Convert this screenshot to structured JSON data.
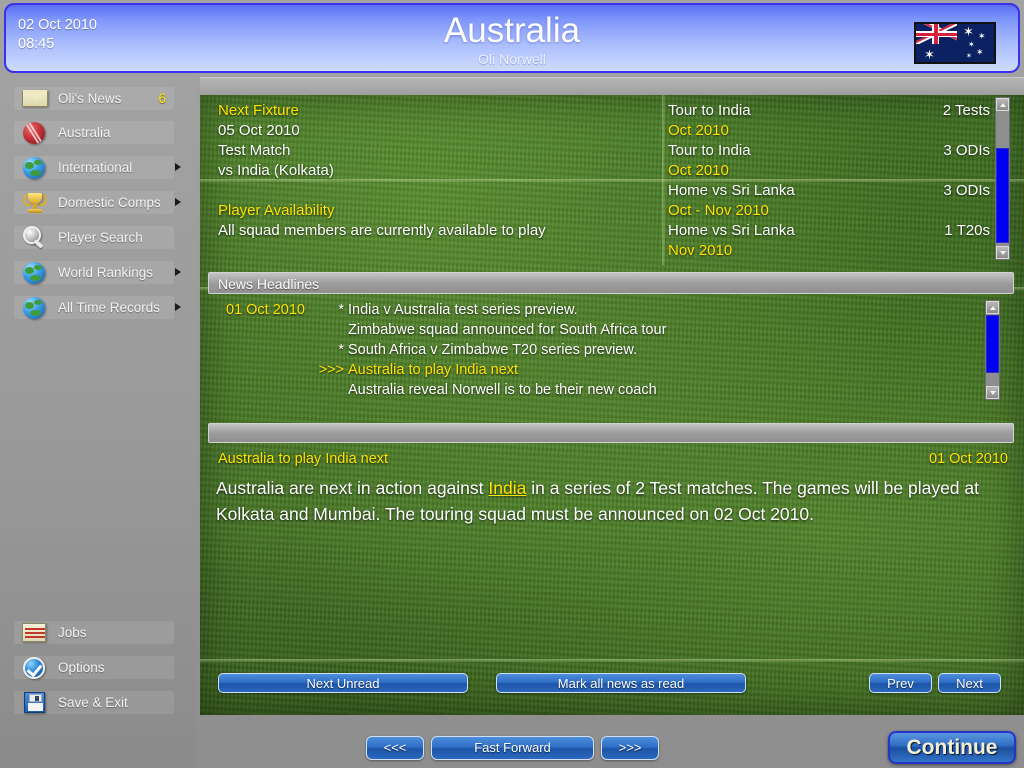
{
  "header": {
    "date": "02 Oct 2010",
    "time": "08:45",
    "title": "Australia",
    "subtitle": "Oli Norwell",
    "flag_name": "australia-flag",
    "accent_blue": "#3a30ee",
    "accent_yellow": "#ffe400"
  },
  "sidebar": {
    "items": [
      {
        "label": "Oli's News",
        "icon": "envelope-icon",
        "badge": "6",
        "arrow": false
      },
      {
        "label": "Australia",
        "icon": "cricket-ball-icon",
        "badge": "",
        "arrow": false
      },
      {
        "label": "International",
        "icon": "globe-icon",
        "badge": "",
        "arrow": true
      },
      {
        "label": "Domestic Comps",
        "icon": "trophy-icon",
        "badge": "",
        "arrow": true
      },
      {
        "label": "Player Search",
        "icon": "magnifier-icon",
        "badge": "",
        "arrow": false
      },
      {
        "label": "World Rankings",
        "icon": "globe-icon",
        "badge": "",
        "arrow": true
      },
      {
        "label": "All Time Records",
        "icon": "globe-icon",
        "badge": "",
        "arrow": true
      }
    ],
    "bottom_items": [
      {
        "label": "Jobs",
        "icon": "clipboard-icon"
      },
      {
        "label": "Options",
        "icon": "check-circle-icon"
      },
      {
        "label": "Save & Exit",
        "icon": "floppy-disk-icon"
      }
    ]
  },
  "fixture": {
    "heading": "Next Fixture",
    "date": "05 Oct 2010",
    "type": "Test Match",
    "opponent": "vs India (Kolkata)"
  },
  "availability": {
    "heading": "Player Availability",
    "text": "All squad members are currently available to play"
  },
  "tours": {
    "rows": [
      {
        "name": "Tour to India",
        "count": "2 Tests",
        "date": "Oct 2010"
      },
      {
        "name": "Tour to India",
        "count": "3 ODIs",
        "date": "Oct 2010"
      },
      {
        "name": "Home vs Sri Lanka",
        "count": "3 ODIs",
        "date": "Oct - Nov 2010"
      },
      {
        "name": "Home vs Sri Lanka",
        "count": "1 T20s",
        "date": "Nov 2010"
      }
    ]
  },
  "news": {
    "section_title": "News Headlines",
    "rows": [
      {
        "date": "01 Oct 2010",
        "mark": "*",
        "text": "India v Australia test series preview.",
        "selected": false
      },
      {
        "date": "",
        "mark": "",
        "text": "Zimbabwe squad announced for South Africa tour",
        "selected": false
      },
      {
        "date": "",
        "mark": "*",
        "text": "South Africa v Zimbabwe T20 series preview.",
        "selected": false
      },
      {
        "date": "",
        "mark": ">>>",
        "text": "Australia to play India next",
        "selected": true
      },
      {
        "date": "",
        "mark": "",
        "text": "Australia reveal Norwell is to be their new coach",
        "selected": false
      }
    ]
  },
  "article": {
    "title": "Australia to play India next",
    "date": "01 Oct 2010",
    "body_part1": "Australia are next in action against ",
    "body_link": "India",
    "body_part2": " in a series of 2 Test matches. The games will be played at Kolkata and Mumbai. The touring squad must be announced on 02 Oct 2010."
  },
  "news_buttons": {
    "next_unread": "Next Unread",
    "mark_all": "Mark all news as read",
    "prev": "Prev",
    "next": "Next"
  },
  "toolbar": {
    "back": "<<<",
    "fast_forward": "Fast Forward",
    "forward": ">>>",
    "continue": "Continue"
  }
}
